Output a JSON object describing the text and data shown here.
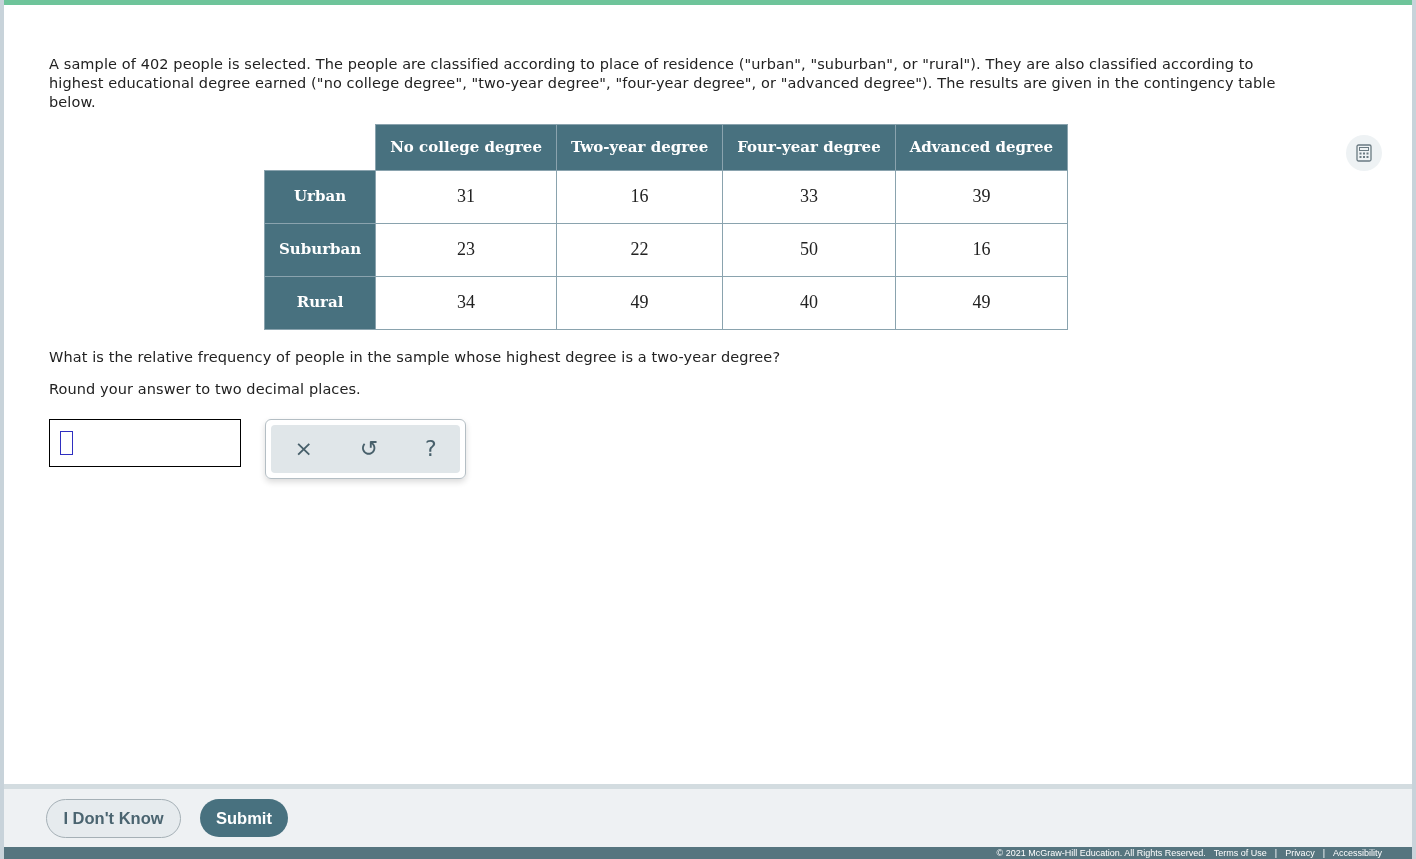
{
  "question": {
    "intro": "A sample of 402 people is selected. The people are classified according to place of residence (\"urban\", \"suburban\", or \"rural\"). They are also classified according to highest educational degree earned (\"no college degree\", \"two-year degree\", \"four-year degree\", or \"advanced degree\"). The results are given in the contingency table below.",
    "prompt": "What is the relative frequency of people in the sample whose highest degree is a two-year degree?",
    "instruction": "Round your answer to two decimal places."
  },
  "table": {
    "columns": [
      "No college degree",
      "Two-year degree",
      "Four-year degree",
      "Advanced degree"
    ],
    "rows": [
      {
        "label": "Urban",
        "cells": [
          "31",
          "16",
          "33",
          "39"
        ]
      },
      {
        "label": "Suburban",
        "cells": [
          "23",
          "22",
          "50",
          "16"
        ]
      },
      {
        "label": "Rural",
        "cells": [
          "34",
          "49",
          "40",
          "49"
        ]
      }
    ]
  },
  "answer_tools": {
    "clear": "×",
    "undo": "↺",
    "help": "?"
  },
  "buttons": {
    "dont_know": "I Don't Know",
    "submit": "Submit"
  },
  "footer": {
    "copyright": "© 2021 McGraw-Hill Education. All Rights Reserved.",
    "links": [
      "Terms of Use",
      "Privacy",
      "Accessibility"
    ],
    "separator": "|"
  }
}
